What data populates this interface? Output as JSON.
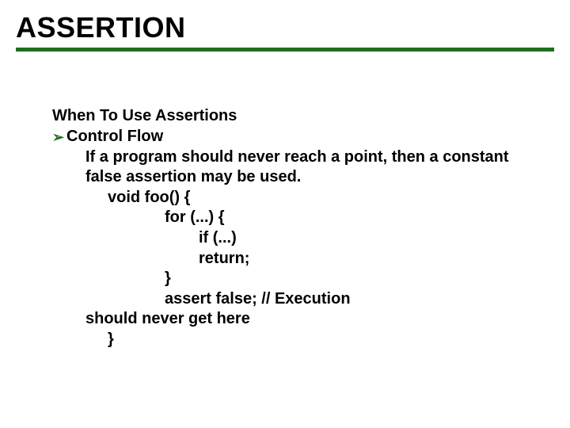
{
  "title": "ASSERTION",
  "heading": "When To Use Assertions",
  "bullet": {
    "label": "Control Flow"
  },
  "desc": "If a program should never reach a point, then a constant false assertion may be used.",
  "code": {
    "l1": "void foo() {",
    "l2": "for (...) {",
    "l3": "if (...)",
    "l4": "return;",
    "l5": "}",
    "l6": "assert false; // Execution",
    "l7": "should never get here",
    "l8": "}"
  }
}
